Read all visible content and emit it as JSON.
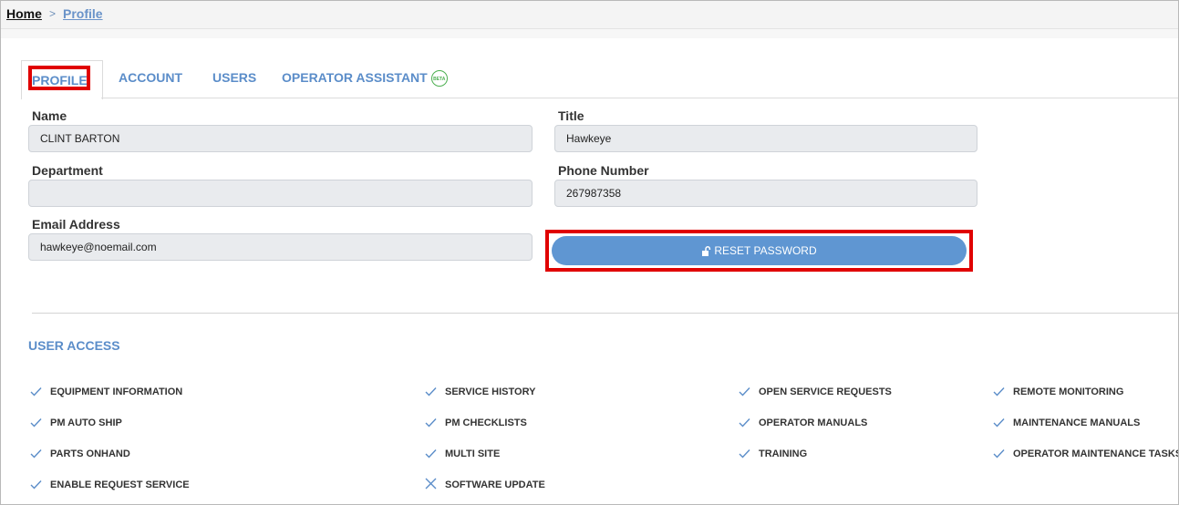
{
  "breadcrumb": {
    "home": "Home",
    "separator": ">",
    "current": "Profile"
  },
  "tabs": [
    {
      "label": "PROFILE",
      "active": true
    },
    {
      "label": "ACCOUNT"
    },
    {
      "label": "USERS"
    },
    {
      "label": "OPERATOR ASSISTANT",
      "badge": "BETA"
    }
  ],
  "form": {
    "name": {
      "label": "Name",
      "value": "CLINT BARTON"
    },
    "title": {
      "label": "Title",
      "value": "Hawkeye"
    },
    "department": {
      "label": "Department",
      "value": ""
    },
    "phone": {
      "label": "Phone Number",
      "value": "267987358"
    },
    "email": {
      "label": "Email Address",
      "value": "hawkeye@noemail.com"
    },
    "reset_button": "RESET PASSWORD"
  },
  "user_access": {
    "title": "USER ACCESS",
    "items": [
      {
        "label": "EQUIPMENT INFORMATION",
        "enabled": true
      },
      {
        "label": "SERVICE HISTORY",
        "enabled": true
      },
      {
        "label": "OPEN SERVICE REQUESTS",
        "enabled": true
      },
      {
        "label": "REMOTE MONITORING",
        "enabled": true
      },
      {
        "label": "PM AUTO SHIP",
        "enabled": true
      },
      {
        "label": "PM CHECKLISTS",
        "enabled": true
      },
      {
        "label": "OPERATOR MANUALS",
        "enabled": true
      },
      {
        "label": "MAINTENANCE MANUALS",
        "enabled": true
      },
      {
        "label": "PARTS ONHAND",
        "enabled": true
      },
      {
        "label": "MULTI SITE",
        "enabled": true
      },
      {
        "label": "TRAINING",
        "enabled": true
      },
      {
        "label": "OPERATOR MAINTENANCE TASKS",
        "enabled": true
      },
      {
        "label": "ENABLE REQUEST SERVICE",
        "enabled": true
      },
      {
        "label": "SOFTWARE UPDATE",
        "enabled": false
      }
    ]
  },
  "colors": {
    "accent": "#5b8dc9",
    "button": "#5f96d2",
    "highlight": "#e00000",
    "beta": "#4caf50"
  }
}
